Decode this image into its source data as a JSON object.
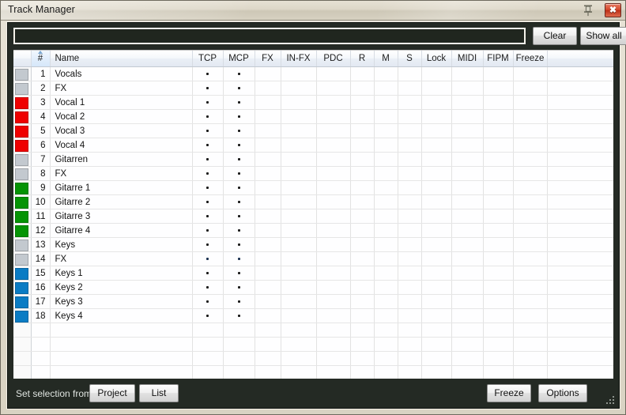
{
  "window": {
    "title": "Track Manager",
    "pin_icon": "pushpin-icon",
    "close_icon": "close-icon",
    "close_glyph": "✖",
    "accent_selection": "#3d9bf0",
    "titlebar_color": "#ddd7c8",
    "panel_color": "#242a24"
  },
  "search": {
    "value": "",
    "placeholder": "",
    "clear_label": "Clear",
    "show_all_label": "Show all"
  },
  "table": {
    "columns": [
      {
        "key": "swatch",
        "label": ""
      },
      {
        "key": "num",
        "label": "#",
        "sorted": true,
        "sort_dir": "asc"
      },
      {
        "key": "name",
        "label": "Name"
      },
      {
        "key": "tcp",
        "label": "TCP"
      },
      {
        "key": "mcp",
        "label": "MCP"
      },
      {
        "key": "fx",
        "label": "FX"
      },
      {
        "key": "infx",
        "label": "IN-FX"
      },
      {
        "key": "pdc",
        "label": "PDC"
      },
      {
        "key": "r",
        "label": "R"
      },
      {
        "key": "m",
        "label": "M"
      },
      {
        "key": "s",
        "label": "S"
      },
      {
        "key": "lock",
        "label": "Lock"
      },
      {
        "key": "midi",
        "label": "MIDI"
      },
      {
        "key": "fipm",
        "label": "FIPM"
      },
      {
        "key": "freeze",
        "label": "Freeze"
      },
      {
        "key": "filler",
        "label": ""
      }
    ],
    "dot_glyph": "•",
    "rows": [
      {
        "num": "1",
        "name": "Vocals",
        "color": "#c3c9cf",
        "tcp": true,
        "mcp": true,
        "selected": false
      },
      {
        "num": "2",
        "name": "FX",
        "color": "#c3c9cf",
        "tcp": true,
        "mcp": true,
        "selected": false
      },
      {
        "num": "3",
        "name": "Vocal 1",
        "color": "#ef0000",
        "tcp": true,
        "mcp": true,
        "selected": false
      },
      {
        "num": "4",
        "name": "Vocal 2",
        "color": "#ef0000",
        "tcp": true,
        "mcp": true,
        "selected": false
      },
      {
        "num": "5",
        "name": "Vocal 3",
        "color": "#ef0000",
        "tcp": true,
        "mcp": true,
        "selected": false
      },
      {
        "num": "6",
        "name": "Vocal 4",
        "color": "#ef0000",
        "tcp": true,
        "mcp": true,
        "selected": false
      },
      {
        "num": "7",
        "name": "Gitarren",
        "color": "#c3c9cf",
        "tcp": true,
        "mcp": true,
        "selected": false
      },
      {
        "num": "8",
        "name": "FX",
        "color": "#c3c9cf",
        "tcp": true,
        "mcp": true,
        "selected": false
      },
      {
        "num": "9",
        "name": "Gitarre 1",
        "color": "#059405",
        "tcp": true,
        "mcp": true,
        "selected": false
      },
      {
        "num": "10",
        "name": "Gitarre 2",
        "color": "#059405",
        "tcp": true,
        "mcp": true,
        "selected": false
      },
      {
        "num": "11",
        "name": "Gitarre 3",
        "color": "#059405",
        "tcp": true,
        "mcp": true,
        "selected": false
      },
      {
        "num": "12",
        "name": "Gitarre 4",
        "color": "#059405",
        "tcp": true,
        "mcp": true,
        "selected": false
      },
      {
        "num": "13",
        "name": "Keys",
        "color": "#c3c9cf",
        "tcp": true,
        "mcp": true,
        "selected": false
      },
      {
        "num": "14",
        "name": "FX",
        "color": "#c3c9cf",
        "tcp": true,
        "mcp": true,
        "selected": true
      },
      {
        "num": "15",
        "name": "Keys 1",
        "color": "#0a7cc4",
        "tcp": true,
        "mcp": true,
        "selected": false
      },
      {
        "num": "16",
        "name": "Keys 2",
        "color": "#0a7cc4",
        "tcp": true,
        "mcp": true,
        "selected": false
      },
      {
        "num": "17",
        "name": "Keys 3",
        "color": "#0a7cc4",
        "tcp": true,
        "mcp": true,
        "selected": false
      },
      {
        "num": "18",
        "name": "Keys 4",
        "color": "#0a7cc4",
        "tcp": true,
        "mcp": true,
        "selected": false
      }
    ],
    "empty_row_count": 5
  },
  "footer": {
    "set_selection_label": "Set selection from:",
    "project_label": "Project",
    "list_label": "List",
    "freeze_label": "Freeze",
    "options_label": "Options",
    "grip_icon": "resize-grip-icon"
  }
}
